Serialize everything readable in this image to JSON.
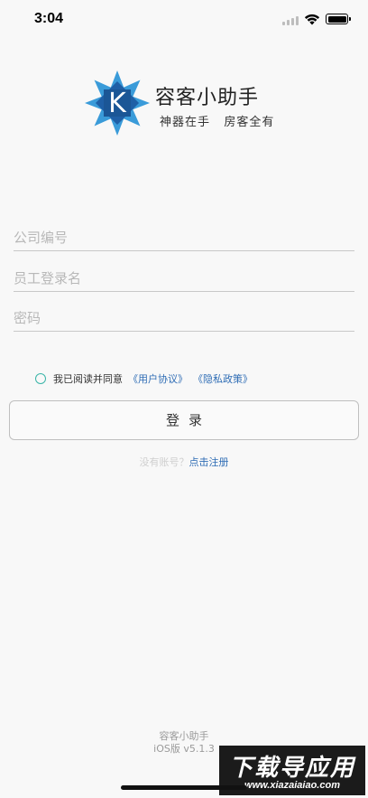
{
  "status_bar": {
    "time": "3:04"
  },
  "app": {
    "logo_letter": "K",
    "title": "容客小助手",
    "slogan": "神器在手   房客全有",
    "colors": {
      "logo_dark": "#1f5fa6",
      "logo_light": "#3a9bd9",
      "link": "#2f6db5",
      "radio": "#3ab5a8"
    }
  },
  "form": {
    "company_placeholder": "公司编号",
    "username_placeholder": "员工登录名",
    "password_placeholder": "密码"
  },
  "agreement": {
    "text": "我已阅读并同意",
    "user_agreement": "《用户协议》",
    "privacy_policy": "《隐私政策》"
  },
  "login_button": "登录",
  "register": {
    "prompt": "没有账号？",
    "link": "点击注册"
  },
  "footer": {
    "name": "容客小助手",
    "version": "iOS版 v5.1.3"
  },
  "watermark": {
    "main": "下载导应用",
    "url": "www.xiazaiaiao.com"
  }
}
